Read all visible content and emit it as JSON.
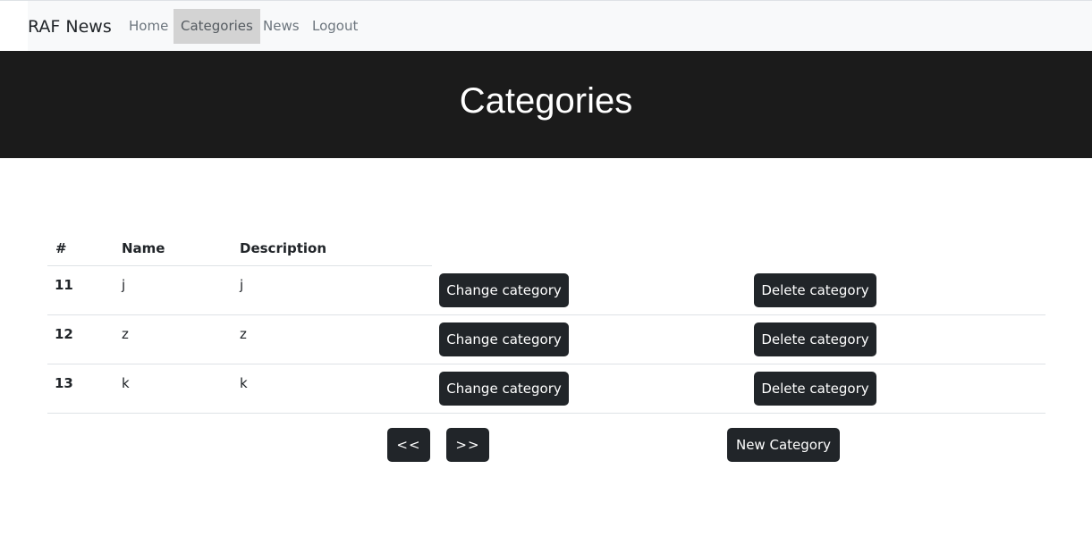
{
  "navbar": {
    "brand": "RAF News",
    "links": [
      {
        "label": "Home"
      },
      {
        "label": "Categories"
      },
      {
        "label": "News"
      },
      {
        "label": "Logout"
      }
    ]
  },
  "header": {
    "title": "Categories"
  },
  "table": {
    "columns": [
      "#",
      "Name",
      "Description"
    ],
    "rows": [
      {
        "id": "11",
        "name": "j",
        "description": "j"
      },
      {
        "id": "12",
        "name": "z",
        "description": "z"
      },
      {
        "id": "13",
        "name": "k",
        "description": "k"
      }
    ],
    "change_label": "Change category",
    "delete_label": "Delete category"
  },
  "pagination": {
    "prev_label": "<<",
    "next_label": ">>"
  },
  "actions": {
    "new_label": "New Category"
  },
  "colors": {
    "navbar_bg": "#f8f9fa",
    "hero_bg": "#1b1b1b",
    "button_bg": "#212529",
    "active_link_bg": "#d3d3d3"
  }
}
